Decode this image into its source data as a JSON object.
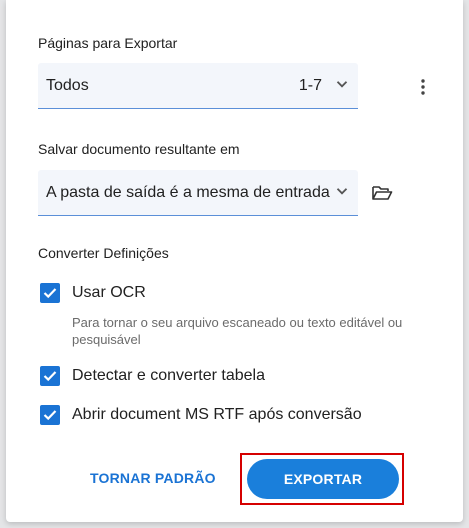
{
  "pages_section": {
    "label": "Páginas para Exportar",
    "select_value": "Todos",
    "select_range": "1-7",
    "more_icon": "more-vertical-icon"
  },
  "save_section": {
    "label": "Salvar documento resultante em",
    "select_value": "A pasta de saída é a mesma de entrada",
    "folder_icon": "folder-open-icon"
  },
  "settings_section": {
    "label": "Converter Definições",
    "options": [
      {
        "label": "Usar OCR",
        "checked": true,
        "hint": "Para tornar o seu arquivo escaneado ou texto editável ou pesquisável"
      },
      {
        "label": "Detectar e converter tabela",
        "checked": true
      },
      {
        "label": "Abrir document MS RTF após conversão",
        "checked": true
      }
    ]
  },
  "actions": {
    "set_default_label": "TORNAR PADRÃO",
    "export_label": "EXPORTAR"
  },
  "colors": {
    "accent": "#1a73d4",
    "primary_button": "#1a7fdb",
    "highlight": "#d50000"
  }
}
